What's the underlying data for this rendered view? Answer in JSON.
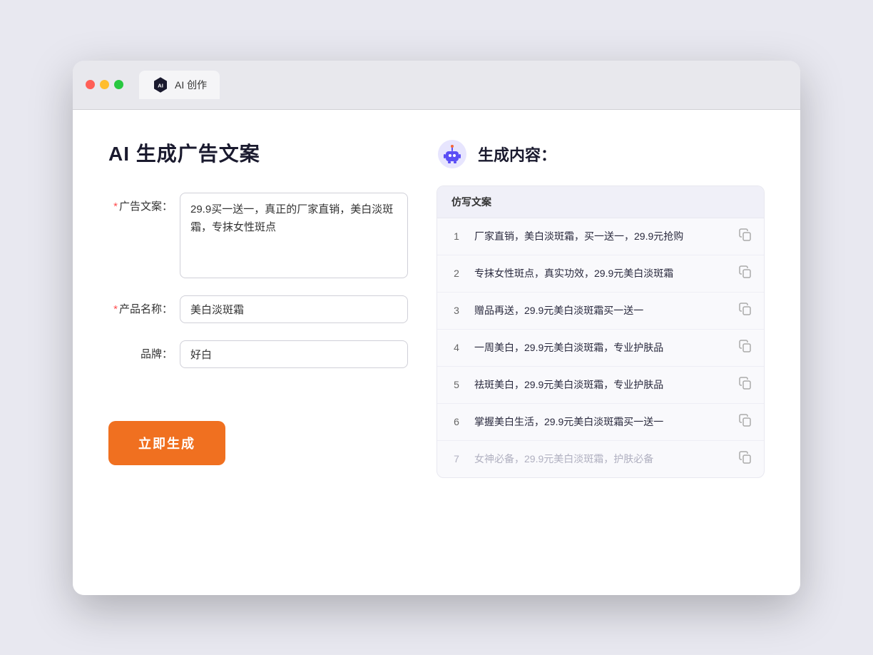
{
  "window": {
    "tab_title": "AI 创作"
  },
  "left": {
    "page_title": "AI 生成广告文案",
    "field_ad_label": "广告文案：",
    "field_ad_required": "*",
    "field_ad_value": "29.9买一送一，真正的厂家直销，美白淡斑霜，专抹女性斑点",
    "field_product_label": "产品名称：",
    "field_product_required": "*",
    "field_product_value": "美白淡斑霜",
    "field_brand_label": "品牌：",
    "field_brand_value": "好白",
    "button_label": "立即生成"
  },
  "right": {
    "header_title": "生成内容：",
    "table_header": "仿写文案",
    "results": [
      {
        "id": 1,
        "text": "厂家直销，美白淡斑霜，买一送一，29.9元抢购",
        "faded": false
      },
      {
        "id": 2,
        "text": "专抹女性斑点，真实功效，29.9元美白淡斑霜",
        "faded": false
      },
      {
        "id": 3,
        "text": "赠品再送，29.9元美白淡斑霜买一送一",
        "faded": false
      },
      {
        "id": 4,
        "text": "一周美白，29.9元美白淡斑霜，专业护肤品",
        "faded": false
      },
      {
        "id": 5,
        "text": "祛斑美白，29.9元美白淡斑霜，专业护肤品",
        "faded": false
      },
      {
        "id": 6,
        "text": "掌握美白生活，29.9元美白淡斑霜买一送一",
        "faded": false
      },
      {
        "id": 7,
        "text": "女神必备，29.9元美白淡斑霜，护肤必备",
        "faded": true
      }
    ]
  }
}
